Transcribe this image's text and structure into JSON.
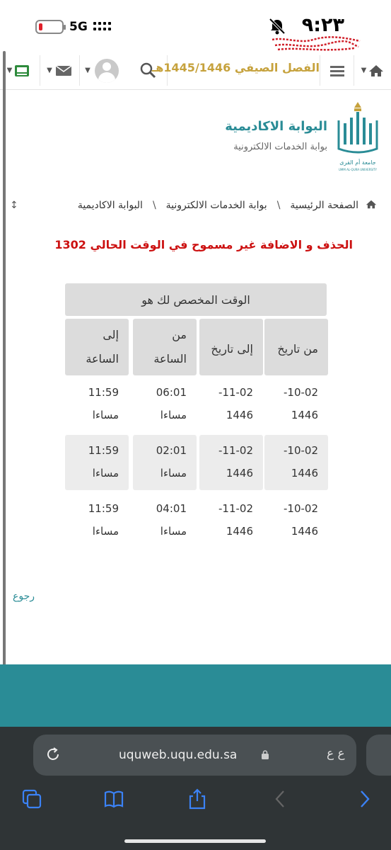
{
  "status": {
    "time": "٩:٢٣",
    "network": "5G",
    "battery_color": "#e0202a"
  },
  "nav": {
    "title": "الفصل الصيفي 1445/1446هـ",
    "icons": [
      "home-icon",
      "menu-icon",
      "search-icon",
      "avatar",
      "mail-icon",
      "terminal-icon"
    ]
  },
  "header": {
    "portal_title": "البوابة الاكاديمية",
    "portal_subtitle": "بوابة الخدمات الالكترونية",
    "logo_text": "جامعة أم القرى",
    "logo_text_en": "UMM AL-QURA UNIVERSITY"
  },
  "breadcrumb": {
    "items": [
      "الصفحة الرئيسية",
      "بوابة الخدمات الالكترونية",
      "البوابة الاكاديمية"
    ],
    "separator": "\\"
  },
  "message": "الحذف و الاضافة غير مسموح في الوقت الحالي 1302",
  "table": {
    "caption": "الوقت المخصص لك هو",
    "headers": [
      [
        "من تاريخ"
      ],
      [
        "إلى تاريخ"
      ],
      [
        "من",
        "الساعة"
      ],
      [
        "إلى",
        "الساعة"
      ]
    ],
    "rows": [
      {
        "from_date": [
          "10-02-",
          "1446"
        ],
        "to_date": [
          "11-02-",
          "1446"
        ],
        "from_time": [
          "06:01",
          "مساءا"
        ],
        "to_time": [
          "11:59",
          "مساءا"
        ]
      },
      {
        "from_date": [
          "10-02-",
          "1446"
        ],
        "to_date": [
          "11-02-",
          "1446"
        ],
        "from_time": [
          "02:01",
          "مساءا"
        ],
        "to_time": [
          "11:59",
          "مساءا"
        ]
      },
      {
        "from_date": [
          "10-02-",
          "1446"
        ],
        "to_date": [
          "11-02-",
          "1446"
        ],
        "from_time": [
          "04:01",
          "مساءا"
        ],
        "to_time": [
          "11:59",
          "مساءا"
        ]
      }
    ]
  },
  "back_label": "رجوع",
  "browser": {
    "url": "uquweb.uqu.edu.sa",
    "text_size_label": "ع ع"
  },
  "colors": {
    "accent": "#2a8c96",
    "gold": "#c6a23d",
    "error": "#cc1111"
  }
}
